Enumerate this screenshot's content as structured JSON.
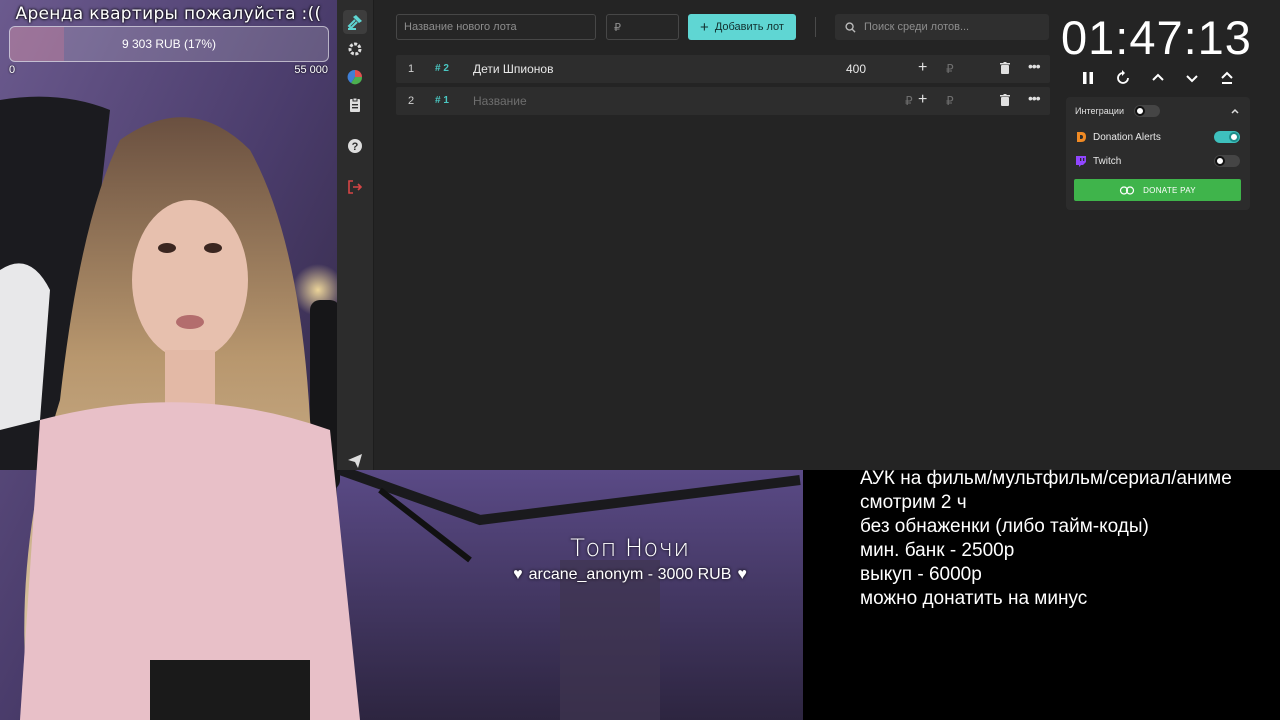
{
  "goal": {
    "title": "Аренда квартиры пожалуйста :((",
    "progress_text": "9 303 RUB (17%)",
    "progress_fraction": 0.17,
    "min_label": "0",
    "max_label": "55 000"
  },
  "sidebar": {
    "items": [
      {
        "icon": "gavel-icon"
      },
      {
        "icon": "gear-icon"
      },
      {
        "icon": "pie-chart-icon"
      },
      {
        "icon": "clipboard-icon"
      },
      {
        "icon": "help-icon"
      },
      {
        "icon": "logout-icon"
      },
      {
        "icon": "send-icon"
      }
    ]
  },
  "toolbar": {
    "new_lot_placeholder": "Название нового лота",
    "amount_placeholder": "₽",
    "add_button_label": "Добавить лот",
    "search_placeholder": "Поиск среди лотов..."
  },
  "lots": [
    {
      "index": "1",
      "id": "# 2",
      "name": "Дети Шпионов",
      "amount": "400",
      "currency": "₽"
    },
    {
      "index": "2",
      "id": "# 1",
      "name": "Название",
      "amount": "₽",
      "currency": "₽"
    }
  ],
  "timer": {
    "value": "01:47:13"
  },
  "integrations": {
    "label": "Интеграции",
    "items": [
      {
        "name": "Donation Alerts",
        "enabled": true
      },
      {
        "name": "Twitch",
        "enabled": false
      }
    ],
    "donate_pay_label": "DONATE PAY"
  },
  "overlay": {
    "top_night_title": "Топ Ночи",
    "top_night_entry": "arcane_anonym - 3000 RUB"
  },
  "rules": {
    "lines": [
      "АУК на фильм/мультфильм/сериал/аниме",
      "смотрим 2 ч",
      "без обнаженки (либо тайм-коды)",
      "мин. банк - 2500р",
      "выкуп - 6000р",
      "можно донатить на минус"
    ]
  },
  "colors": {
    "accent": "#5fd6d3",
    "donate_pay": "#3fb44b",
    "app_bg": "#242424",
    "row_bg": "#2d2d2d"
  }
}
